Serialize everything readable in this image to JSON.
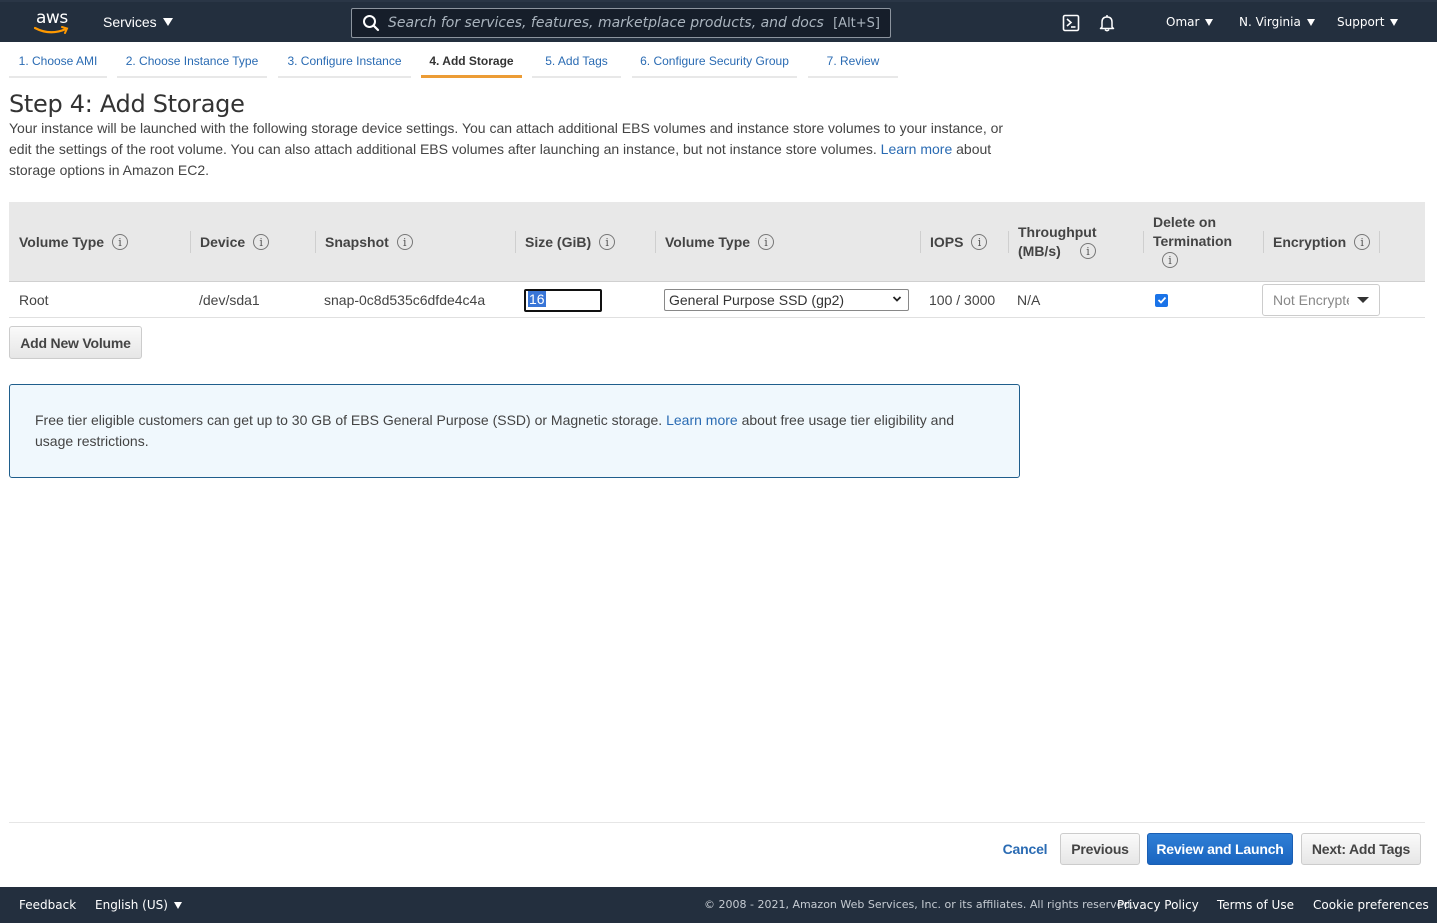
{
  "nav": {
    "logo_text": "aws",
    "services_label": "Services",
    "search_placeholder": "Search for services, features, marketplace products, and docs",
    "search_hotkey": "[Alt+S]",
    "user_label": "Omar",
    "region_label": "N. Virginia",
    "support_label": "Support"
  },
  "wizard": {
    "tabs": [
      {
        "label": "1. Choose AMI"
      },
      {
        "label": "2. Choose Instance Type"
      },
      {
        "label": "3. Configure Instance"
      },
      {
        "label": "4. Add Storage",
        "active": true
      },
      {
        "label": "5. Add Tags"
      },
      {
        "label": "6. Configure Security Group"
      },
      {
        "label": "7. Review"
      }
    ]
  },
  "page": {
    "title": "Step 4: Add Storage",
    "description_before_link": "Your instance will be launched with the following storage device settings. You can attach additional EBS volumes and instance store volumes to your instance, or edit the settings of the root volume. You can also attach additional EBS volumes after launching an instance, but not instance store volumes. ",
    "description_link": "Learn more",
    "description_after_link": " about storage options in Amazon EC2."
  },
  "table": {
    "columns": [
      {
        "label": "Volume Type"
      },
      {
        "label": "Device"
      },
      {
        "label": "Snapshot"
      },
      {
        "label": "Size (GiB)"
      },
      {
        "label": "Volume Type"
      },
      {
        "label": "IOPS"
      },
      {
        "label": "Throughput (MB/s)"
      },
      {
        "label": "Delete on Termination"
      },
      {
        "label": "Encryption"
      }
    ],
    "info_glyph": "i",
    "rows": [
      {
        "volume_type": "Root",
        "device": "/dev/sda1",
        "snapshot": "snap-0c8d535c6dfde4c4a",
        "size": "16",
        "ebs_volume_type": "General Purpose SSD (gp2)",
        "iops": "100 / 3000",
        "throughput": "N/A",
        "delete_on_termination": true,
        "encryption": "Not Encrypted"
      }
    ]
  },
  "add_volume_label": "Add New Volume",
  "info_box": {
    "text_before_link": "Free tier eligible customers can get up to 30 GB of EBS General Purpose (SSD) or Magnetic storage. ",
    "link": "Learn more",
    "text_after_link": " about free usage tier eligibility and usage restrictions."
  },
  "actions": {
    "cancel": "Cancel",
    "previous": "Previous",
    "review_launch": "Review and Launch",
    "next": "Next: Add Tags"
  },
  "footer": {
    "feedback": "Feedback",
    "language": "English (US)",
    "copyright": "© 2008 - 2021, Amazon Web Services, Inc. or its affiliates. All rights reserved.",
    "privacy": "Privacy Policy",
    "terms": "Terms of Use",
    "cookies": "Cookie preferences"
  }
}
